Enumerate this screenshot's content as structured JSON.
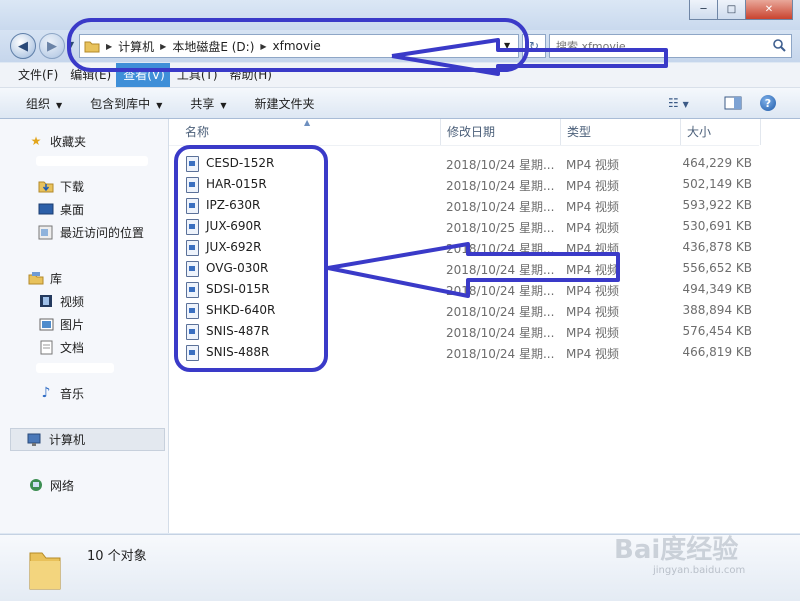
{
  "window": {
    "controls": {
      "minimize": "─",
      "maximize": "□",
      "close": "✕"
    }
  },
  "address": {
    "crumbs": [
      "计算机",
      "本地磁盘E (D:)",
      "xfmovie"
    ]
  },
  "search": {
    "placeholder": "搜索 xfmovie"
  },
  "menu": {
    "items": [
      "文件(F)",
      "编辑(E)",
      "查看(V)",
      "工具(T)",
      "帮助(H)"
    ],
    "active_index": 2
  },
  "toolbar": {
    "organize": "组织",
    "include_library": "包含到库中",
    "share": "共享",
    "new_folder": "新建文件夹"
  },
  "nav": {
    "favorites": "收藏夹",
    "downloads": "下载",
    "desktop": "桌面",
    "recent": "最近访问的位置",
    "libraries": "库",
    "videos": "视频",
    "pictures": "图片",
    "documents": "文档",
    "music": "音乐",
    "computer": "计算机",
    "network": "网络"
  },
  "columns": {
    "name": "名称",
    "date": "修改日期",
    "type": "类型",
    "size": "大小"
  },
  "files": [
    {
      "name": "CESD-152R",
      "date": "2018/10/24 星期...",
      "type": "MP4 视频",
      "size": "464,229 KB"
    },
    {
      "name": "HAR-015R",
      "date": "2018/10/24 星期...",
      "type": "MP4 视频",
      "size": "502,149 KB"
    },
    {
      "name": "IPZ-630R",
      "date": "2018/10/24 星期...",
      "type": "MP4 视频",
      "size": "593,922 KB"
    },
    {
      "name": "JUX-690R",
      "date": "2018/10/25 星期...",
      "type": "MP4 视频",
      "size": "530,691 KB"
    },
    {
      "name": "JUX-692R",
      "date": "2018/10/24 星期...",
      "type": "MP4 视频",
      "size": "436,878 KB"
    },
    {
      "name": "OVG-030R",
      "date": "2018/10/24 星期...",
      "type": "MP4 视频",
      "size": "556,652 KB"
    },
    {
      "name": "SDSI-015R",
      "date": "2018/10/24 星期...",
      "type": "MP4 视频",
      "size": "494,349 KB"
    },
    {
      "name": "SHKD-640R",
      "date": "2018/10/24 星期...",
      "type": "MP4 视频",
      "size": "388,894 KB"
    },
    {
      "name": "SNIS-487R",
      "date": "2018/10/24 星期...",
      "type": "MP4 视频",
      "size": "576,454 KB"
    },
    {
      "name": "SNIS-488R",
      "date": "2018/10/24 星期...",
      "type": "MP4 视频",
      "size": "466,819 KB"
    }
  ],
  "status": {
    "count": "10 个对象"
  },
  "watermark": {
    "brand": "Bai度经验",
    "url": "jingyan.baidu.com"
  },
  "colors": {
    "annotation": "#3a3ac8",
    "menu_active": "#3f8fd8"
  }
}
